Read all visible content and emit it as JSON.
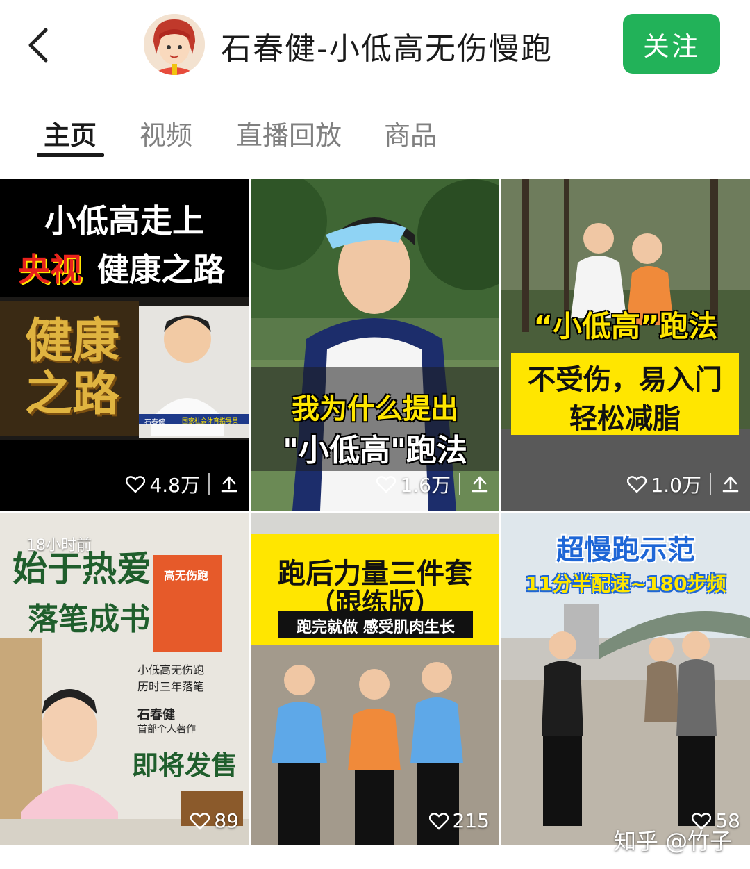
{
  "header": {
    "profile_name": "石春健-小低高无伤慢跑",
    "follow_label": "关注"
  },
  "tabs": [
    {
      "label": "主页",
      "active": true
    },
    {
      "label": "视频",
      "active": false
    },
    {
      "label": "直播回放",
      "active": false
    },
    {
      "label": "商品",
      "active": false
    }
  ],
  "videos": [
    {
      "likes": "4.8万",
      "title_line1": "小低高走上",
      "title_hl": "央视",
      "title_line2": "健康之路",
      "logo_text": "健康之路",
      "caption_name": "石春健",
      "caption_title": "国家社会体育指导员"
    },
    {
      "likes": "1.6万",
      "title_line1": "我为什么提出",
      "title_line2": "\"小低高\"跑法"
    },
    {
      "likes": "1.0万",
      "title_line1": "“小低高”跑法",
      "title_line2": "不受伤，易入门",
      "title_line3": "轻松减脂"
    },
    {
      "likes": "89",
      "time_ago": "18小时前",
      "title_line1": "始于热爱",
      "title_line2": "落笔成书",
      "book_title": "高无伤跑",
      "desc_line1": "小低高无伤跑",
      "desc_line2": "历时三年落笔",
      "author": "石春健",
      "author_sub": "首部个人著作",
      "release": "即将发售"
    },
    {
      "likes": "215",
      "title_line1": "跑后力量三件套",
      "title_line2": "（跟练版）",
      "subtitle": "跑完就做  感受肌肉生长"
    },
    {
      "likes": "58",
      "title_line1": "超慢跑示范",
      "title_line2": "11分半配速~180步频"
    }
  ],
  "watermark": "知乎 @竹子",
  "colors": {
    "follow_green": "#22b259",
    "highlight_yellow": "#ffe600",
    "highlight_red": "#e8221c"
  }
}
